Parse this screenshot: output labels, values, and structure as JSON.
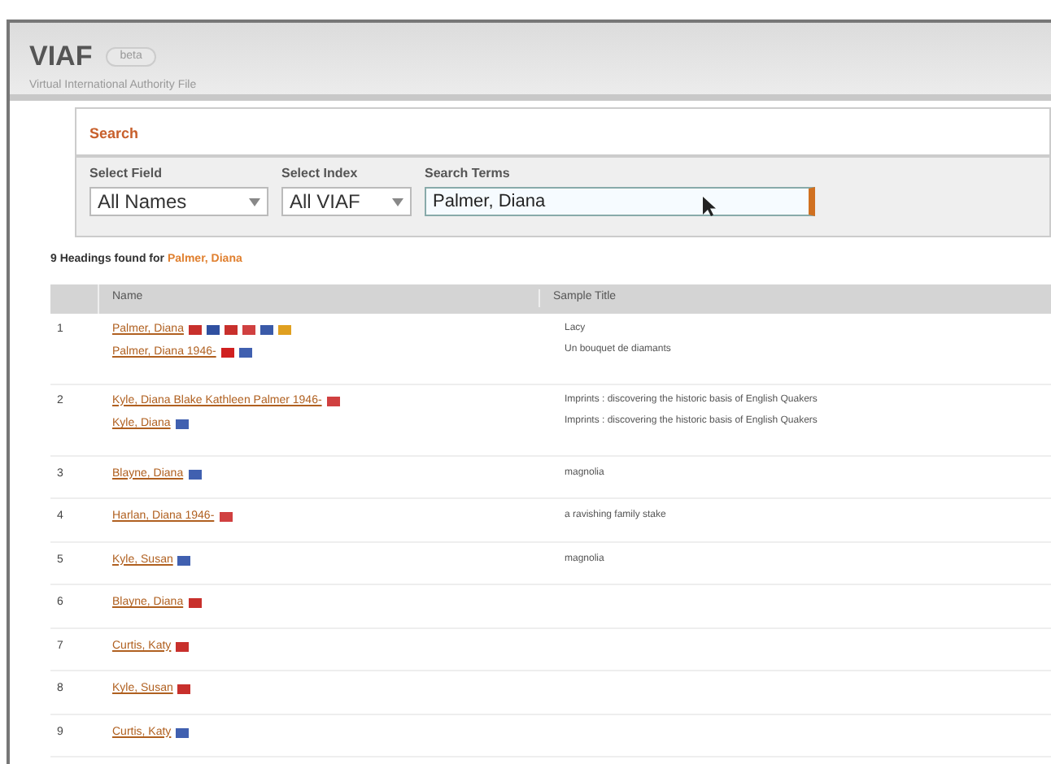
{
  "header": {
    "title": "VIAF",
    "badge": "beta",
    "subtitle": "Virtual International Authority File"
  },
  "search": {
    "title": "Search",
    "fields": [
      {
        "kind": "select",
        "label": "Select Field",
        "value": "All Names"
      },
      {
        "kind": "select",
        "label": "Select Index",
        "value": "All VIAF"
      },
      {
        "kind": "text",
        "label": "Search Terms",
        "value": "Palmer, Diana"
      }
    ]
  },
  "summary": {
    "prefix": "9 Headings found for",
    "query": "Palmer, Diana"
  },
  "table": {
    "columns": [
      "Name",
      "Sample Title"
    ],
    "rows": [
      {
        "number": "1",
        "names": [
          {
            "text": "Palmer, Diana",
            "flags": [
              {
                "color": "#c8302c"
              },
              {
                "color": "#3050a0"
              },
              {
                "color": "#c8302c"
              },
              {
                "color": "#d04040"
              },
              {
                "color": "#3a5aa8"
              },
              {
                "color": "#e0a020"
              }
            ]
          },
          {
            "text": "Palmer, Diana 1946-",
            "flags": [
              {
                "color": "#d02020"
              },
              {
                "color": "#4060b0"
              }
            ]
          }
        ],
        "titles": [
          "Lacy",
          "Un bouquet de diamants"
        ]
      },
      {
        "number": "2",
        "names": [
          {
            "text": "Kyle, Diana Blake Kathleen Palmer 1946-",
            "flags": [
              {
                "color": "#d04040"
              }
            ]
          },
          {
            "text": "Kyle, Diana",
            "flags": [
              {
                "color": "#4060b0"
              }
            ]
          }
        ],
        "titles": [
          "Imprints : discovering the historic basis of English Quakers",
          "Imprints : discovering the historic basis of English Quakers"
        ]
      },
      {
        "number": "3",
        "names": [
          {
            "text": "Blayne, Diana",
            "flags": [
              {
                "color": "#4060b0"
              }
            ]
          }
        ],
        "titles": [
          "magnolia"
        ]
      },
      {
        "number": "4",
        "names": [
          {
            "text": "Harlan, Diana 1946-",
            "flags": [
              {
                "color": "#d04040"
              }
            ]
          }
        ],
        "titles": [
          "a ravishing family stake"
        ]
      },
      {
        "number": "5",
        "names": [
          {
            "text": "Kyle, Susan",
            "flags": [
              {
                "color": "#4060b0"
              }
            ]
          }
        ],
        "titles": [
          "magnolia"
        ]
      },
      {
        "number": "6",
        "names": [
          {
            "text": "Blayne, Diana",
            "flags": [
              {
                "color": "#c8302c"
              }
            ]
          }
        ],
        "titles": []
      },
      {
        "number": "7",
        "names": [
          {
            "text": "Curtis, Katy",
            "flags": [
              {
                "color": "#c8302c"
              }
            ]
          }
        ],
        "titles": []
      },
      {
        "number": "8",
        "names": [
          {
            "text": "Kyle, Susan",
            "flags": [
              {
                "color": "#c8302c"
              }
            ]
          }
        ],
        "titles": []
      },
      {
        "number": "9",
        "names": [
          {
            "text": "Curtis, Katy",
            "flags": [
              {
                "color": "#4060b0"
              }
            ]
          }
        ],
        "titles": []
      }
    ]
  }
}
